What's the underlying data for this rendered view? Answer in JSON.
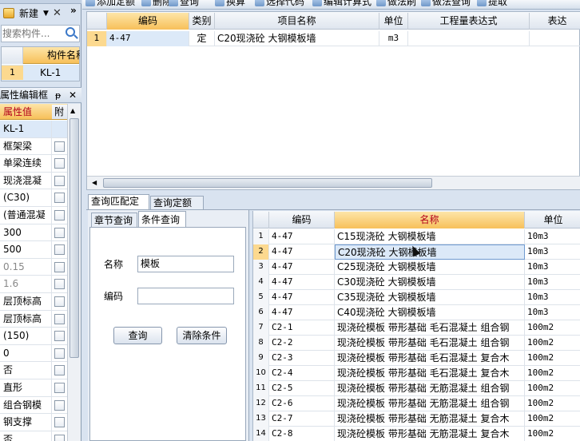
{
  "left": {
    "new_label": "新建",
    "search_placeholder": "搜索构件...",
    "comp_header": "构件名称",
    "comp_row": {
      "num": "1",
      "name": "KL-1"
    },
    "prop_panel_title": "属性编辑框",
    "pin_glyph": "ᵽ",
    "prop_col_value": "属性值",
    "prop_col_extra": "附",
    "props": [
      "KL-1",
      "框架梁",
      "单梁连续",
      "现浇混凝",
      "(C30)",
      "(普通混凝",
      "300",
      "500",
      "0.15",
      "1.6",
      "层顶标高",
      "层顶标高",
      "(150)",
      "0",
      "否",
      "直形",
      "组合钢模",
      "钢支撑",
      "否"
    ]
  },
  "toolbar": {
    "items": [
      "添加定额",
      "删除",
      "查询",
      "换算",
      "选择代码",
      "编辑计算式",
      "做法刷",
      "做法查询",
      "提取"
    ]
  },
  "quota_table": {
    "headers": [
      "编码",
      "类别",
      "项目名称",
      "单位",
      "工程量表达式",
      "表达"
    ],
    "rows": [
      {
        "num": "1",
        "code": "4-47",
        "type": "定",
        "name": "C20现浇砼 大钢模板墙",
        "unit": "m3",
        "expr": "",
        "desc": ""
      }
    ]
  },
  "bottom_tabs": [
    "查询匹配定额",
    "查询定额库"
  ],
  "search_tabs": [
    "章节查询",
    "条件查询"
  ],
  "form": {
    "name_label": "名称",
    "name_value": "模板",
    "code_label": "编码",
    "code_value": "",
    "query_btn": "查询",
    "clear_btn": "清除条件"
  },
  "results": {
    "headers": [
      "编码",
      "名称",
      "单位"
    ],
    "rows": [
      {
        "num": "1",
        "code": "4-47",
        "name": "C15现浇砼 大钢模板墙",
        "unit": "10m3"
      },
      {
        "num": "2",
        "code": "4-47",
        "name": "C20现浇砼 大钢模板墙",
        "unit": "10m3"
      },
      {
        "num": "3",
        "code": "4-47",
        "name": "C25现浇砼 大钢模板墙",
        "unit": "10m3"
      },
      {
        "num": "4",
        "code": "4-47",
        "name": "C30现浇砼 大钢模板墙",
        "unit": "10m3"
      },
      {
        "num": "5",
        "code": "4-47",
        "name": "C35现浇砼 大钢模板墙",
        "unit": "10m3"
      },
      {
        "num": "6",
        "code": "4-47",
        "name": "C40现浇砼 大钢模板墙",
        "unit": "10m3"
      },
      {
        "num": "7",
        "code": "C2-1",
        "name": "现浇砼模板 带形基础 毛石混凝土 组合钢",
        "unit": "100m2"
      },
      {
        "num": "8",
        "code": "C2-2",
        "name": "现浇砼模板 带形基础 毛石混凝土 组合钢",
        "unit": "100m2"
      },
      {
        "num": "9",
        "code": "C2-3",
        "name": "现浇砼模板 带形基础 毛石混凝土 复合木",
        "unit": "100m2"
      },
      {
        "num": "10",
        "code": "C2-4",
        "name": "现浇砼模板 带形基础 毛石混凝土 复合木",
        "unit": "100m2"
      },
      {
        "num": "11",
        "code": "C2-5",
        "name": "现浇砼模板 带形基础 无筋混凝土 组合钢",
        "unit": "100m2"
      },
      {
        "num": "12",
        "code": "C2-6",
        "name": "现浇砼模板 带形基础 无筋混凝土 组合钢",
        "unit": "100m2"
      },
      {
        "num": "13",
        "code": "C2-7",
        "name": "现浇砼模板 带形基础 无筋混凝土 复合木",
        "unit": "100m2"
      },
      {
        "num": "14",
        "code": "C2-8",
        "name": "现浇砼模板 带形基础 无筋混凝土 复合木",
        "unit": "100m2"
      }
    ]
  },
  "colors": {
    "accent": "#f7c05a",
    "selection": "#dce9f8",
    "panel": "#d9e3f0"
  }
}
